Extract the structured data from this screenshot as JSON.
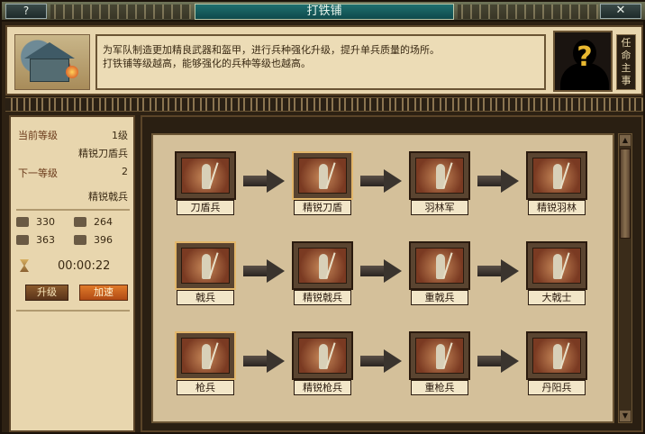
{
  "window": {
    "title": "打铁铺",
    "help_label": "?",
    "close_label": "✕"
  },
  "header": {
    "description_line1": "为军队制造更加精良武器和盔甲，进行兵种强化升级，提升单兵质量的场所。",
    "description_line2": "打铁铺等级越高，能够强化的兵种等级也越高。",
    "appoint_label": "任命主事",
    "portrait_mark": "?"
  },
  "left_panel": {
    "current_level_label": "当前等级",
    "current_level_value": "1级",
    "current_unit": "精锐刀盾兵",
    "next_level_label": "下一等级",
    "next_level_value": "2",
    "next_unit": "精锐戟兵",
    "resources": [
      {
        "icon": "wood-icon",
        "value": "330"
      },
      {
        "icon": "food-icon",
        "value": "264"
      },
      {
        "icon": "stone-icon",
        "value": "363"
      },
      {
        "icon": "iron-icon",
        "value": "396"
      }
    ],
    "timer": "00:00:22",
    "upgrade_label": "升级",
    "speedup_label": "加速"
  },
  "tree": {
    "rows": [
      {
        "units": [
          {
            "name": "刀盾兵",
            "selected": false
          },
          {
            "name": "精锐刀盾",
            "selected": true
          },
          {
            "name": "羽林军",
            "selected": false
          },
          {
            "name": "精锐羽林",
            "selected": false
          }
        ]
      },
      {
        "units": [
          {
            "name": "戟兵",
            "selected": true
          },
          {
            "name": "精锐戟兵",
            "selected": false
          },
          {
            "name": "重戟兵",
            "selected": false
          },
          {
            "name": "大戟士",
            "selected": false
          }
        ]
      },
      {
        "units": [
          {
            "name": "枪兵",
            "selected": true
          },
          {
            "name": "精锐枪兵",
            "selected": false
          },
          {
            "name": "重枪兵",
            "selected": false
          },
          {
            "name": "丹阳兵",
            "selected": false
          }
        ]
      }
    ]
  }
}
